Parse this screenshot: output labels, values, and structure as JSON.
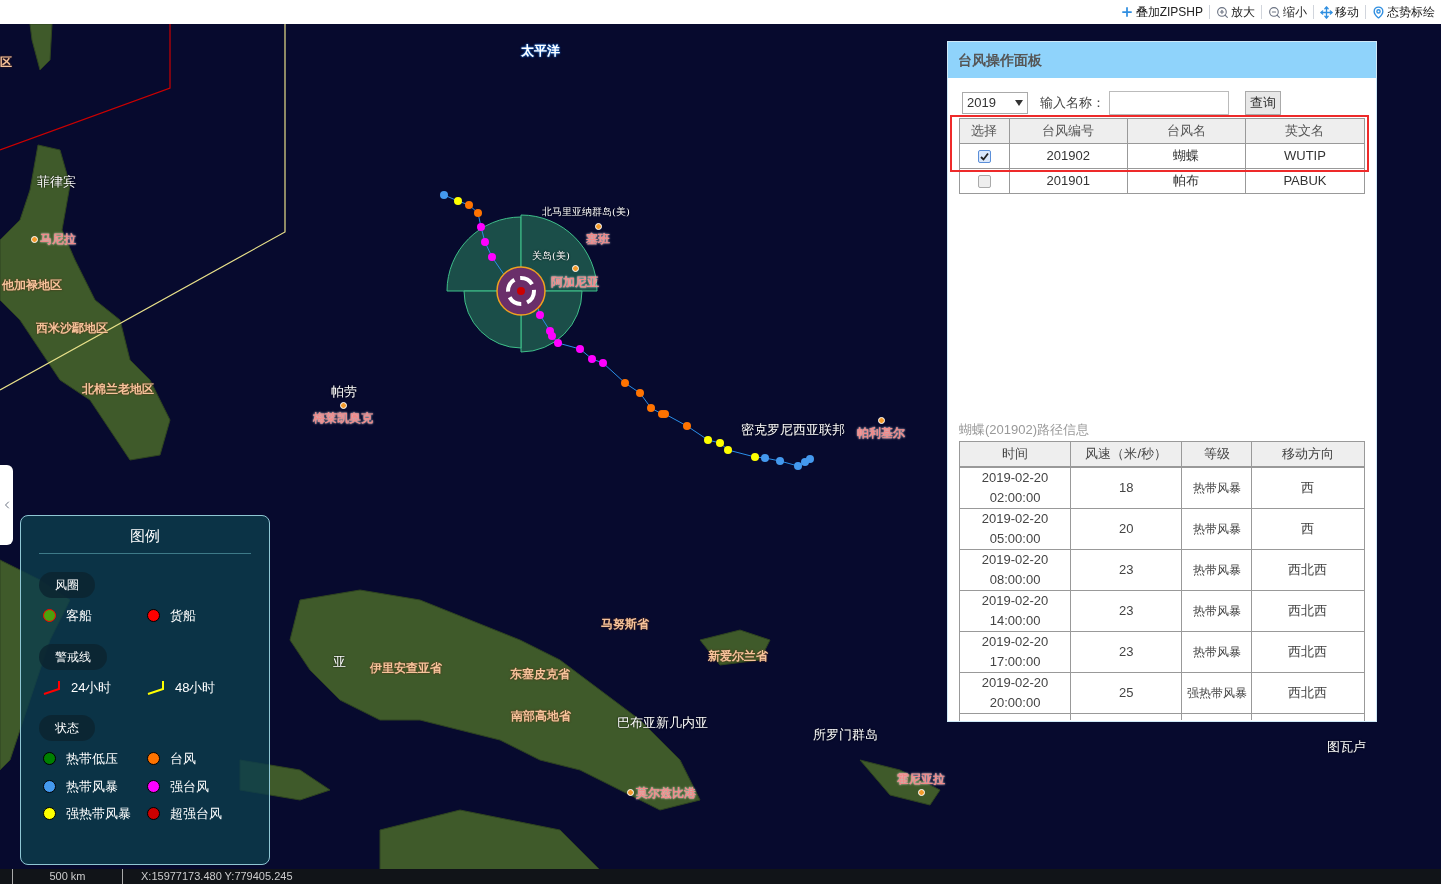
{
  "toolbar": [
    {
      "label": "叠加ZIPSHP",
      "kind": "plus"
    },
    {
      "label": "放大",
      "kind": "zoom-in"
    },
    {
      "label": "缩小",
      "kind": "zoom-out"
    },
    {
      "label": "移动",
      "kind": "move"
    },
    {
      "label": "态势标绘",
      "kind": "pin"
    }
  ],
  "map_labels": [
    {
      "text": "区",
      "kind": "region"
    },
    {
      "text": "太平洋",
      "kind": "ocean"
    },
    {
      "text": "菲律宾",
      "kind": "country"
    },
    {
      "text": "北马里亚纳群岛(美)",
      "kind": "territory"
    },
    {
      "text": "马尼拉",
      "kind": "city"
    },
    {
      "text": "塞班",
      "kind": "city"
    },
    {
      "text": "关岛(美)",
      "kind": "territory"
    },
    {
      "text": "阿加尼亚",
      "kind": "city"
    },
    {
      "text": "他加禄地区",
      "kind": "region"
    },
    {
      "text": "西米沙鄢地区",
      "kind": "region"
    },
    {
      "text": "北棉兰老地区",
      "kind": "region"
    },
    {
      "text": "帕劳",
      "kind": "country"
    },
    {
      "text": "梅莱凯奥克",
      "kind": "city"
    },
    {
      "text": "密克罗尼西亚联邦",
      "kind": "country"
    },
    {
      "text": "帕利基尔",
      "kind": "city"
    },
    {
      "text": "马努斯省",
      "kind": "region"
    },
    {
      "text": "新爱尔兰省",
      "kind": "region"
    },
    {
      "text": "亚",
      "kind": "country"
    },
    {
      "text": "伊里安查亚省",
      "kind": "region"
    },
    {
      "text": "东塞皮克省",
      "kind": "region"
    },
    {
      "text": "南部高地省",
      "kind": "region"
    },
    {
      "text": "巴布亚新几内亚",
      "kind": "country"
    },
    {
      "text": "所罗门群岛",
      "kind": "country"
    },
    {
      "text": "图瓦卢",
      "kind": "country"
    },
    {
      "text": "莫尔兹比港",
      "kind": "city"
    },
    {
      "text": "霍尼亚拉",
      "kind": "city"
    }
  ],
  "panel": {
    "title": "台风操作面板",
    "year": "2019",
    "name_label": "输入名称：",
    "query_button": "查询",
    "columns": [
      "选择",
      "台风编号",
      "台风名",
      "英文名"
    ],
    "typhoons": [
      {
        "checked": true,
        "id": "201902",
        "name": "蝴蝶",
        "english": "WUTIP"
      },
      {
        "checked": false,
        "id": "201901",
        "name": "帕布",
        "english": "PABUK"
      }
    ],
    "path_title": "蝴蝶(201902)路径信息",
    "path_columns": [
      "时间",
      "风速（米/秒）",
      "等级",
      "移动方向"
    ],
    "path_rows": [
      [
        "2019-02-20 02:00:00",
        "18",
        "热带风暴",
        "西"
      ],
      [
        "2019-02-20 05:00:00",
        "20",
        "热带风暴",
        "西"
      ],
      [
        "2019-02-20 08:00:00",
        "23",
        "热带风暴",
        "西北西"
      ],
      [
        "2019-02-20 14:00:00",
        "23",
        "热带风暴",
        "西北西"
      ],
      [
        "2019-02-20 17:00:00",
        "23",
        "热带风暴",
        "西北西"
      ],
      [
        "2019-02-20 20:00:00",
        "25",
        "强热带风暴",
        "西北西"
      ]
    ]
  },
  "legend": {
    "title": "图例",
    "sections": [
      {
        "title": "风圈",
        "items": [
          {
            "label": "客船",
            "kind": "ring",
            "color": "#4ca10c"
          },
          {
            "label": "货船",
            "kind": "dot",
            "color": "#ff0000"
          }
        ]
      },
      {
        "title": "警戒线",
        "items": [
          {
            "label": "24小时",
            "kind": "line",
            "color": "#ff0000"
          },
          {
            "label": "48小时",
            "kind": "line",
            "color": "#ffff00"
          }
        ]
      },
      {
        "title": "状态",
        "items": [
          {
            "label": "热带低压",
            "kind": "dot",
            "color": "#008000"
          },
          {
            "label": "台风",
            "kind": "dot",
            "color": "#ff7300"
          },
          {
            "label": "热带风暴",
            "kind": "dot",
            "color": "#4499ee"
          },
          {
            "label": "强台风",
            "kind": "dot",
            "color": "#ff00ff"
          },
          {
            "label": "强热带风暴",
            "kind": "dot",
            "color": "#ffff00"
          },
          {
            "label": "超强台风",
            "kind": "dot",
            "color": "#cc0000"
          }
        ]
      }
    ]
  },
  "status_bar": {
    "scale": "500 km",
    "coordinates": "X:15977173.480 Y:779405.245"
  }
}
